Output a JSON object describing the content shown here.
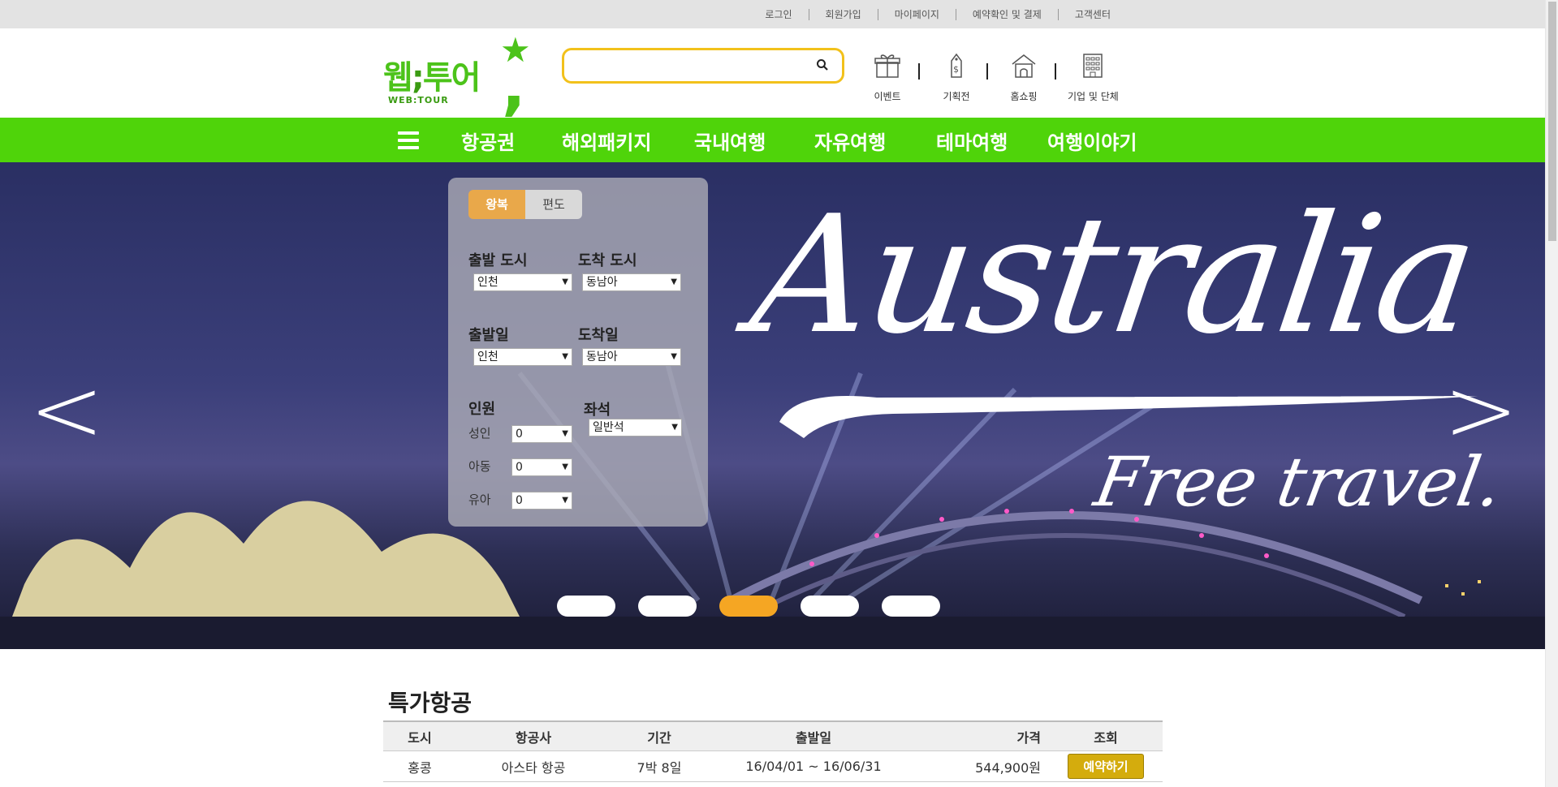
{
  "topbar": {
    "links": [
      "로그인",
      "회원가입",
      "마이페이지",
      "예약확인 및 결제",
      "고객센터"
    ]
  },
  "logo": {
    "korean": "웹",
    "semi": ";",
    "korean2": "투어",
    "english": "WEB:TOUR"
  },
  "search": {
    "placeholder": "",
    "value": ""
  },
  "quick_links": [
    {
      "label": "이벤트",
      "icon": "gift-icon"
    },
    {
      "label": "기획전",
      "icon": "price-tag-icon"
    },
    {
      "label": "홈쇼핑",
      "icon": "home-shopping-icon"
    },
    {
      "label": "기업 및 단체",
      "icon": "building-icon"
    }
  ],
  "nav": {
    "items": [
      "항공권",
      "해외패키지",
      "국내여행",
      "자유여행",
      "테마여행",
      "여행이야기"
    ]
  },
  "hero": {
    "headline": "Australia",
    "tagline": "Free travel.",
    "slides": 5,
    "active_slide": 3,
    "prev": "<",
    "next": ">"
  },
  "booking": {
    "tabs": [
      "왕복",
      "편도"
    ],
    "active_tab": "왕복",
    "depart_city_label": "출발 도시",
    "depart_city_value": "인천",
    "arrive_city_label": "도착 도시",
    "arrive_city_value": "동남아",
    "depart_date_label": "출발일",
    "depart_date_value": "인천",
    "arrive_date_label": "도착일",
    "arrive_date_value": "동남아",
    "people_label": "인원",
    "seat_label": "좌석",
    "seat_value": "일반석",
    "adult_label": "성인",
    "adult_value": "0",
    "child_label": "아동",
    "child_value": "0",
    "infant_label": "유아",
    "infant_value": "0"
  },
  "special": {
    "title": "특가항공",
    "columns": [
      "도시",
      "항공사",
      "기간",
      "출발일",
      "가격",
      "조회"
    ],
    "rows": [
      {
        "city": "홍콩",
        "airline": "아스타 항공",
        "period": "7박 8일",
        "dates": "16/04/01 ~ 16/06/31",
        "price": "544,900원",
        "action": "예약하기"
      }
    ]
  },
  "colors": {
    "brand_green": "#4fd40a",
    "accent_orange": "#e9a84a",
    "search_border": "#f2c11b",
    "book_button": "#d4ac0d"
  }
}
